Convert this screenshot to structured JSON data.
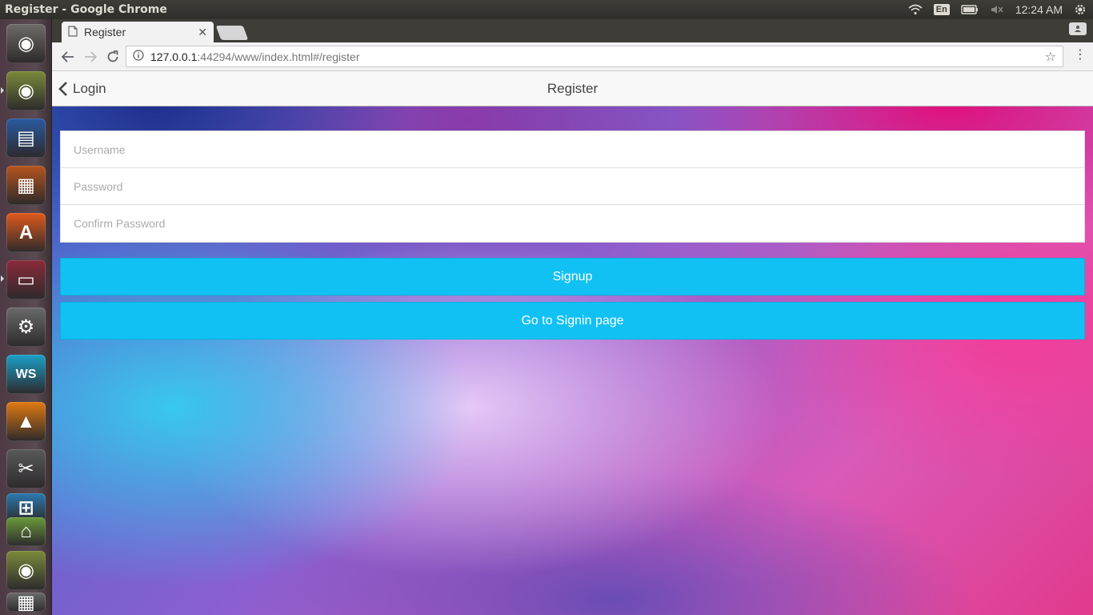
{
  "system": {
    "window_title": "Register - Google Chrome",
    "keyboard_layout": "En",
    "clock": "12:24 AM"
  },
  "launcher": {
    "apps": [
      {
        "name": "ubuntu-dash-icon",
        "color": "#6e6a66"
      },
      {
        "name": "chrome-icon",
        "color": "#7a8a3a"
      },
      {
        "name": "libreoffice-writer-icon",
        "color": "#2a5aa0"
      },
      {
        "name": "libreoffice-impress-icon",
        "color": "#b5541e"
      },
      {
        "name": "software-center-icon",
        "color": "#e05a1c"
      },
      {
        "name": "files-icon",
        "color": "#8a2a3a"
      },
      {
        "name": "system-settings-icon",
        "color": "#6a6a6a"
      },
      {
        "name": "webstorm-icon",
        "color": "#1aa0c8"
      },
      {
        "name": "vlc-icon",
        "color": "#e07a10"
      },
      {
        "name": "wine-tools-icon",
        "color": "#5a5a5a"
      },
      {
        "name": "screen-capture-icon",
        "color": "#2a7ab0"
      },
      {
        "name": "scanner-icon",
        "color": "#6a9a3a"
      },
      {
        "name": "chrome-icon",
        "color": "#7a8a3a"
      },
      {
        "name": "trash-icon",
        "color": "#6a6a6a"
      }
    ]
  },
  "browser": {
    "tab_title": "Register",
    "url_host": "127.0.0.1",
    "url_path": ":44294/www/index.html#/register"
  },
  "app": {
    "back_label": "Login",
    "title": "Register",
    "fields": {
      "username_placeholder": "Username",
      "password_placeholder": "Password",
      "confirm_placeholder": "Confirm Password"
    },
    "signup_label": "Signup",
    "signin_label": "Go to Signin page",
    "accent_color": "#11c1f3"
  }
}
